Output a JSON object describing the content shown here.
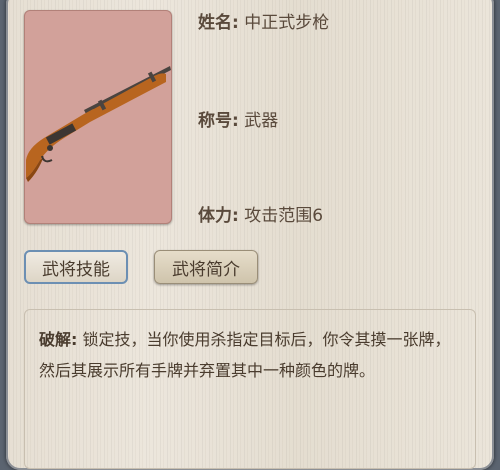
{
  "general": {
    "name_label": "姓名:",
    "name_value": "中正式步枪",
    "title_label": "称号:",
    "title_value": "武器",
    "hp_label": "体力:",
    "hp_value": "攻击范围6"
  },
  "tabs": {
    "skills_label": "武将技能",
    "intro_label": "武将简介"
  },
  "skill": {
    "name": "破解:",
    "description": "锁定技，当你使用杀指定目标后，你令其摸一张牌，然后其展示所有手牌并弃置其中一种颜色的牌。"
  },
  "colors": {
    "portrait_bg": "#d2a19a",
    "active_tab_border": "#6c8fb3"
  }
}
